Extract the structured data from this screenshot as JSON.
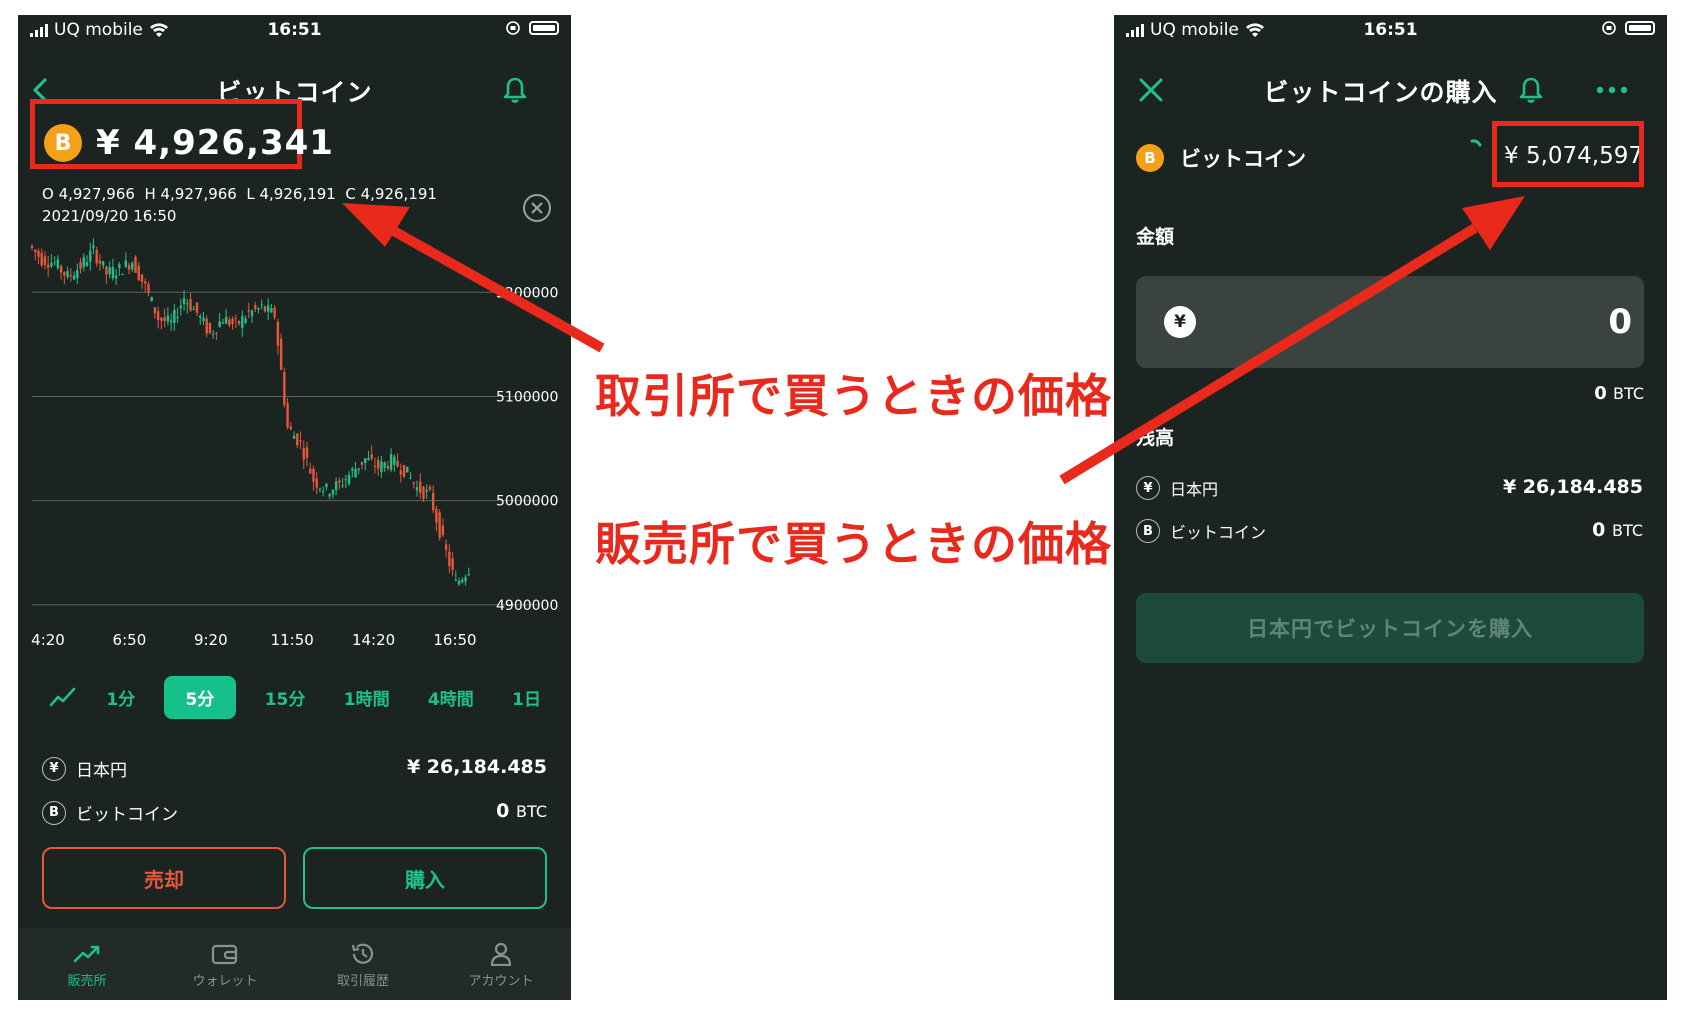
{
  "status_left": {
    "carrier": "UQ mobile",
    "time": "16:51"
  },
  "status_right": {
    "carrier": "UQ mobile",
    "time": "16:51"
  },
  "left": {
    "title": "ビットコイン",
    "price": "¥ 4,926,341",
    "ohlc": "O 4,927,966  H 4,927,966  L 4,926,191  C 4,926,191",
    "datetime": "2021/09/20 16:50",
    "y_ticks": [
      "5200000",
      "5100000",
      "5000000",
      "4900000"
    ],
    "x_ticks": [
      "4:20",
      "6:50",
      "9:20",
      "11:50",
      "14:20",
      "16:50"
    ],
    "timeframes": [
      "1分",
      "5分",
      "15分",
      "1時間",
      "4時間",
      "1日"
    ],
    "active_timeframe": "5分",
    "balance": {
      "jpy_icon": "¥",
      "jpy_label": "日本円",
      "jpy_value": "¥ 26,184.485",
      "btc_icon": "B",
      "btc_label": "ビットコイン",
      "btc_value": "0",
      "btc_unit": "BTC"
    },
    "sell_label": "売却",
    "buy_label": "購入",
    "tabs": [
      "販売所",
      "ウォレット",
      "取引履歴",
      "アカウント"
    ]
  },
  "right": {
    "title": "ビットコインの購入",
    "asset_name": "ビットコイン",
    "price": "¥ 5,074,597",
    "amount_label": "金額",
    "amount_currency": "¥",
    "amount_value": "0",
    "amount_btc": "0",
    "amount_btc_unit": "BTC",
    "balance_label": "残高",
    "balance": {
      "jpy_icon": "¥",
      "jpy_label": "日本円",
      "jpy_value": "¥ 26,184.485",
      "btc_icon": "B",
      "btc_label": "ビットコイン",
      "btc_value": "0",
      "btc_unit": "BTC"
    },
    "buy_button": "日本円でビットコインを購入"
  },
  "annotations": {
    "exchange": "取引所で買うときの価格",
    "sales": "販売所で買うときの価格"
  },
  "colors": {
    "background": "#1b2421",
    "accent_green": "#20c08a",
    "sell_red": "#e8563c",
    "annotation_red": "#e8291c"
  },
  "chart_data": {
    "type": "candlestick",
    "x_tick_labels": [
      "4:20",
      "6:50",
      "9:20",
      "11:50",
      "14:20",
      "16:50"
    ],
    "y_tick_labels": [
      "5200000",
      "5100000",
      "5000000",
      "4900000"
    ],
    "ylim": [
      4895000,
      5255000
    ],
    "close_path": [
      5245000,
      5232000,
      5228000,
      5215000,
      5225000,
      5240000,
      5218000,
      5222000,
      5230000,
      5205000,
      5175000,
      5170000,
      5195000,
      5180000,
      5160000,
      5175000,
      5168000,
      5180000,
      5185000,
      5178000,
      5070000,
      5055000,
      5020000,
      5010000,
      5015000,
      5028000,
      5040000,
      5032000,
      5038000,
      5030000,
      5012000,
      5005000,
      4960000,
      4920000,
      4935000
    ]
  }
}
